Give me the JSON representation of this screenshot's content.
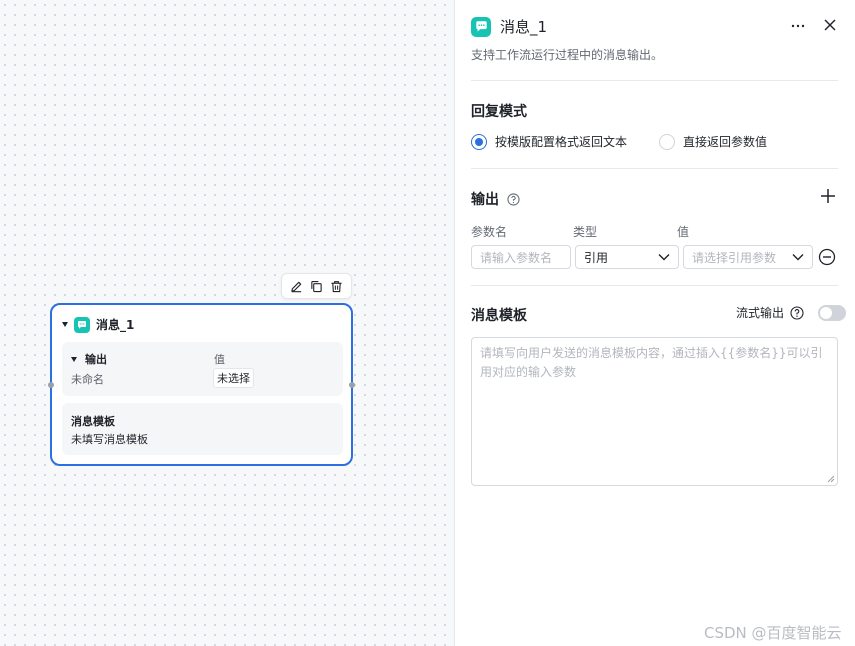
{
  "canvas": {
    "node": {
      "title": "消息_1",
      "output_label": "输出",
      "value_header": "值",
      "param_name": "未命名",
      "value_chip": "未选择",
      "template_label": "消息模板",
      "template_value": "未填写消息模板"
    }
  },
  "panel": {
    "title": "消息_1",
    "description": "支持工作流运行过程中的消息输出。",
    "reply_mode": {
      "title": "回复模式",
      "options": [
        {
          "label": "按模版配置格式返回文本",
          "selected": true
        },
        {
          "label": "直接返回参数值",
          "selected": false
        }
      ]
    },
    "output": {
      "title": "输出",
      "columns": [
        "参数名",
        "类型",
        "值"
      ],
      "row": {
        "name_placeholder": "请输入参数名",
        "type_value": "引用",
        "value_placeholder": "请选择引用参数"
      }
    },
    "template": {
      "title": "消息模板",
      "stream_label": "流式输出",
      "stream_on": false,
      "placeholder": "请填写向用户发送的消息模板内容，通过插入{{参数名}}可以引用对应的输入参数"
    }
  },
  "watermark": "CSDN @百度智能云",
  "colors": {
    "accent": "#2b6fe0",
    "icon_teal": "#17c3b2"
  }
}
